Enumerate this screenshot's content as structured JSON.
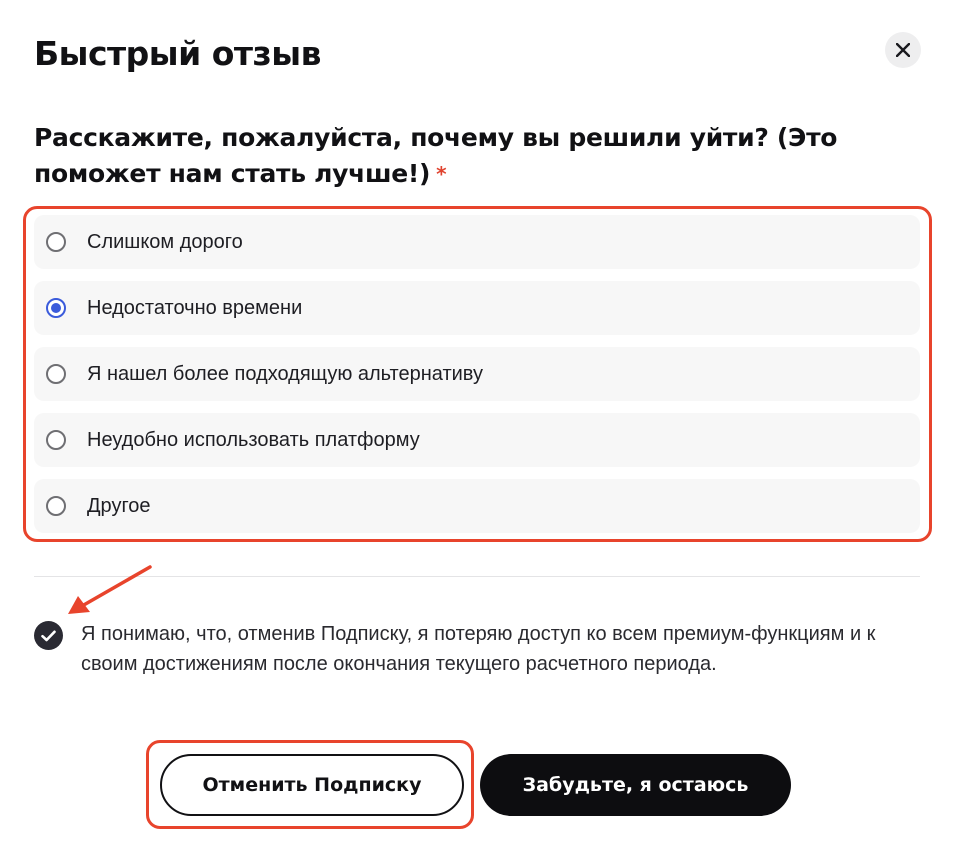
{
  "dialog": {
    "title": "Быстрый отзыв",
    "question": "Расскажите, пожалуйста, почему вы решили уйти? (Это поможет нам стать лучше!)",
    "required_mark": "*"
  },
  "options": [
    {
      "label": "Слишком дорого",
      "selected": false
    },
    {
      "label": "Недостаточно времени",
      "selected": true
    },
    {
      "label": "Я нашел более подходящую альтернативу",
      "selected": false
    },
    {
      "label": "Неудобно использовать платформу",
      "selected": false
    },
    {
      "label": "Другое",
      "selected": false
    }
  ],
  "consent": {
    "checked": true,
    "text": "Я понимаю, что, отменив Подписку, я потеряю доступ ко всем премиум-функциям и к своим достижениям после окончания текущего расчетного периода."
  },
  "buttons": {
    "cancel_label": "Отменить Подписку",
    "stay_label": "Забудьте, я остаюсь"
  },
  "colors": {
    "highlight": "#e8442c",
    "radio_selected": "#3b5bdb",
    "primary_button": "#0d0d10"
  }
}
